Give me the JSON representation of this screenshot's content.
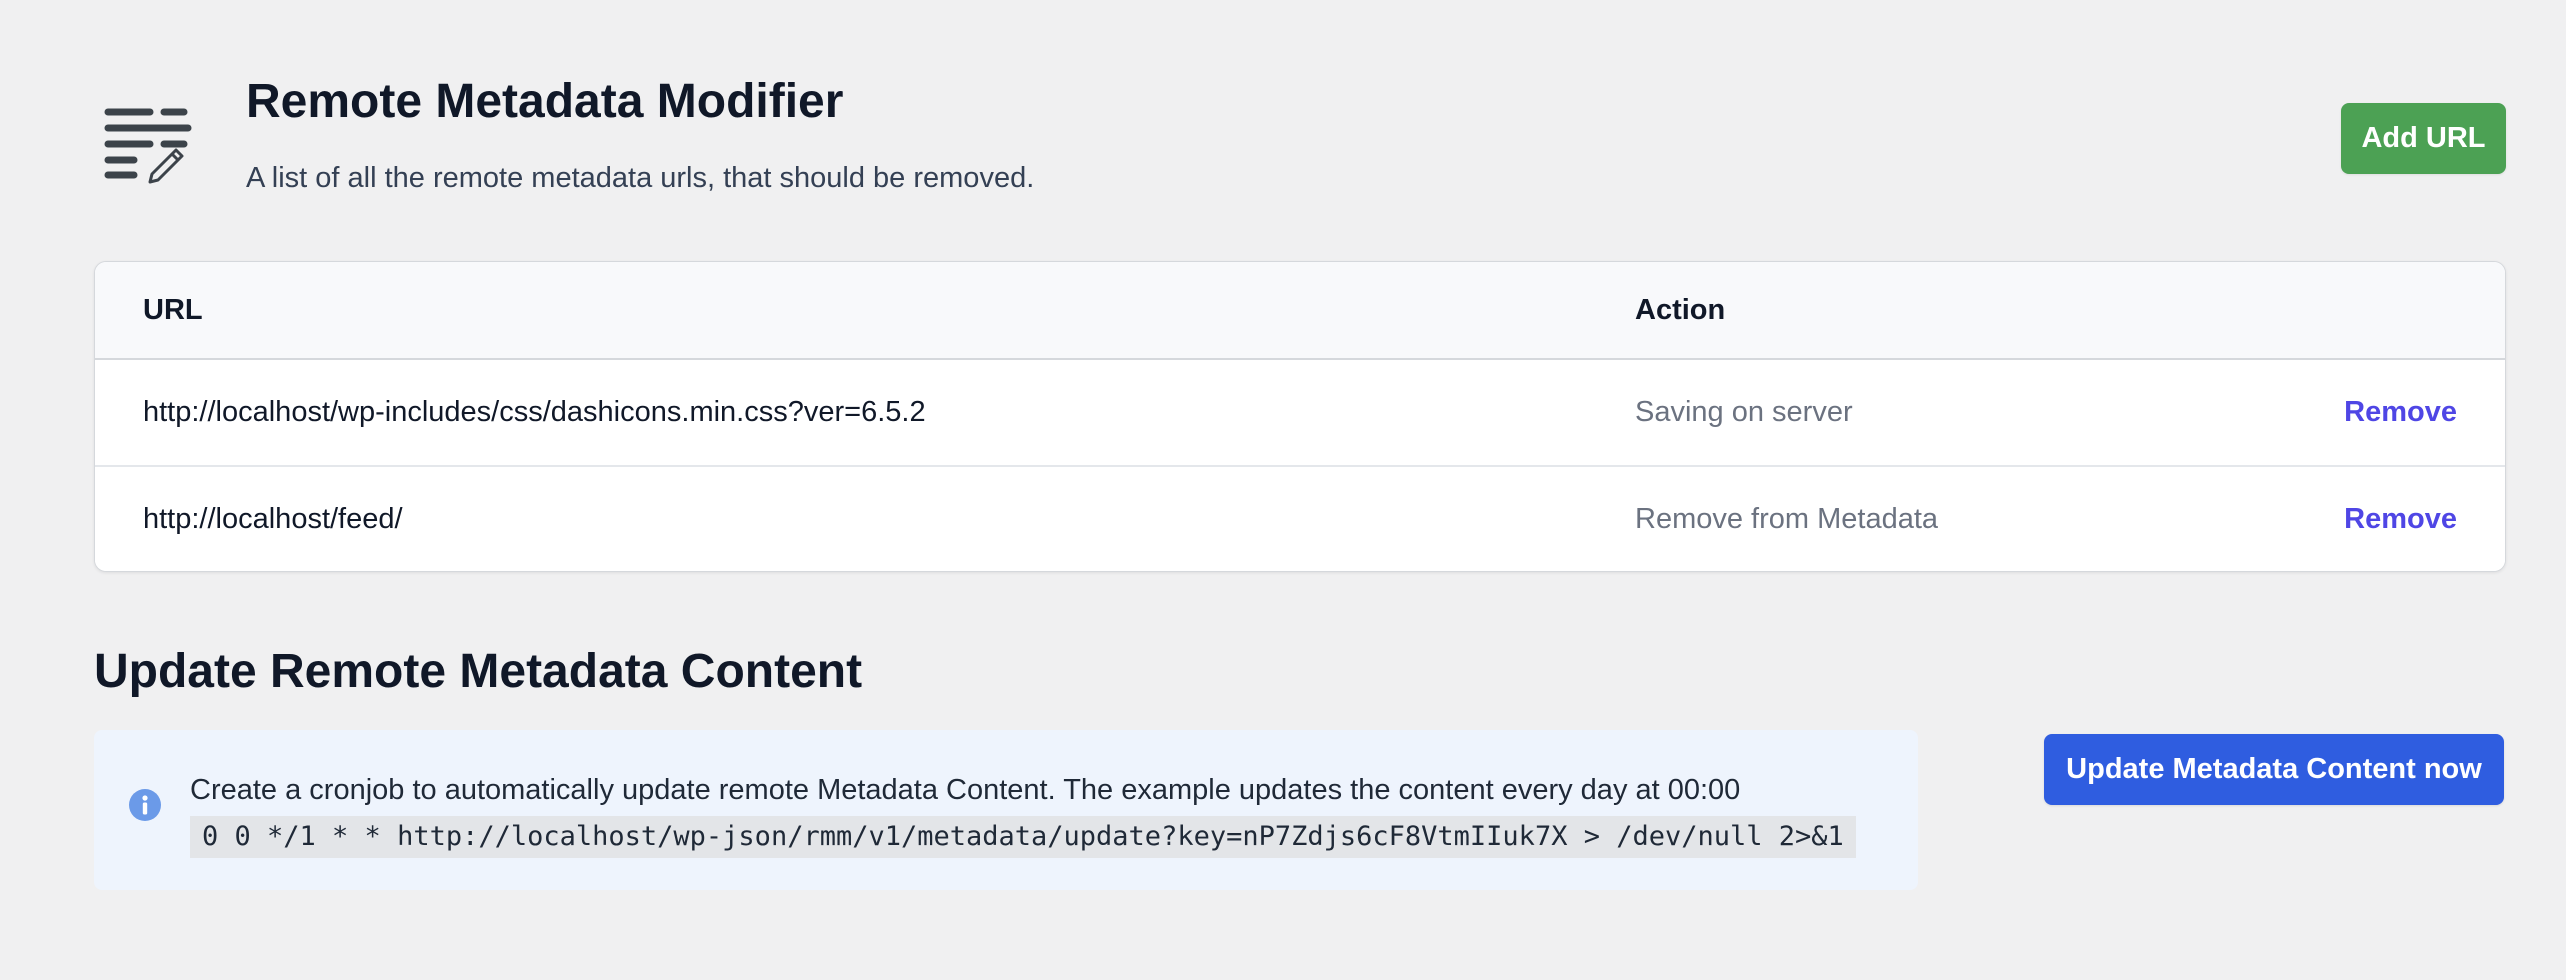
{
  "header": {
    "title": "Remote Metadata Modifier",
    "subtitle": "A list of all the remote metadata urls, that should be removed.",
    "logo_icon": "list-edit-icon",
    "add_button_label": "Add URL",
    "add_button_color": "#4ca154"
  },
  "table": {
    "columns": [
      "URL",
      "Action"
    ],
    "rows": [
      {
        "url": "http://localhost/wp-includes/css/dashicons.min.css?ver=6.5.2",
        "action": "Saving on server",
        "remove_label": "Remove"
      },
      {
        "url": "http://localhost/feed/",
        "action": "Remove from Metadata",
        "remove_label": "Remove"
      }
    ],
    "remove_link_color": "#4f46e5"
  },
  "update_section": {
    "title": "Update Remote Metadata Content",
    "info_icon": "info-circle-icon",
    "info_text": "Create a cronjob to automatically update remote Metadata Content. The example updates the content every day at 00:00",
    "cron_example": "0 0 */1 * * http://localhost/wp-json/rmm/v1/metadata/update?key=nP7Zdjs6cF8VtmIIuk7X > /dev/null 2>&1",
    "update_button_label": "Update Metadata Content now",
    "update_button_color": "#2f5de0"
  }
}
